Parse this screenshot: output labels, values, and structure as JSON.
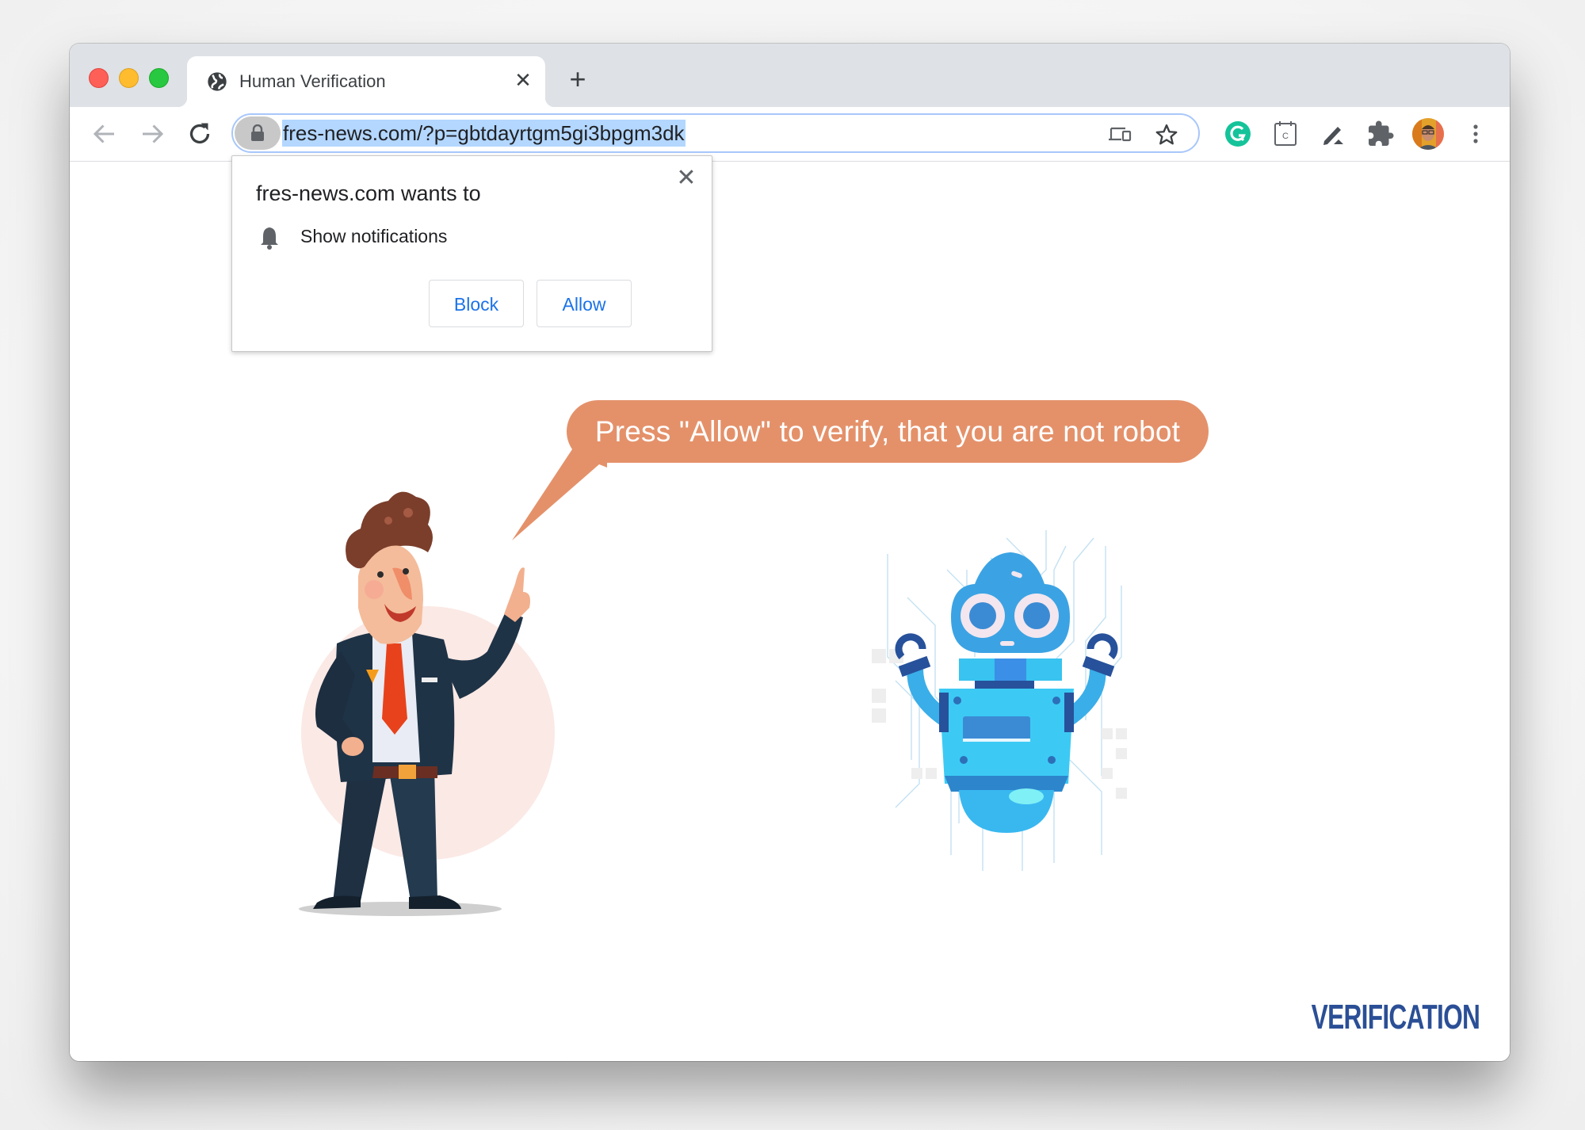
{
  "window": {
    "traffic_lights": [
      "close",
      "minimize",
      "zoom"
    ]
  },
  "tab": {
    "title": "Human Verification",
    "icon": "globe-icon",
    "close_glyph": "✕",
    "new_tab_glyph": "+"
  },
  "toolbar": {
    "back_icon": "arrow-left-icon",
    "forward_icon": "arrow-right-icon",
    "reload_icon": "reload-icon",
    "url": "fres-news.com/?p=gbtdayrtgm5gi3bpgm3dk",
    "omnibox_icons": [
      "cast-devices-icon",
      "star-icon"
    ],
    "extensions": [
      "grammarly-icon",
      "calendar-icon",
      "pen-icon",
      "puzzle-icon",
      "profile-avatar",
      "more-vert-icon"
    ],
    "calendar_letter": "C"
  },
  "permission_popup": {
    "title": "fres-news.com wants to",
    "permission": "Show notifications",
    "close_glyph": "✕",
    "block_label": "Block",
    "allow_label": "Allow"
  },
  "page": {
    "bubble_text": "Press \"Allow\" to verify, that you are not robot",
    "brand_text": "VERIFICATION",
    "colors": {
      "bubble": "#e4916a",
      "brand": "#2b4f96",
      "button_text": "#1a73e8"
    }
  }
}
